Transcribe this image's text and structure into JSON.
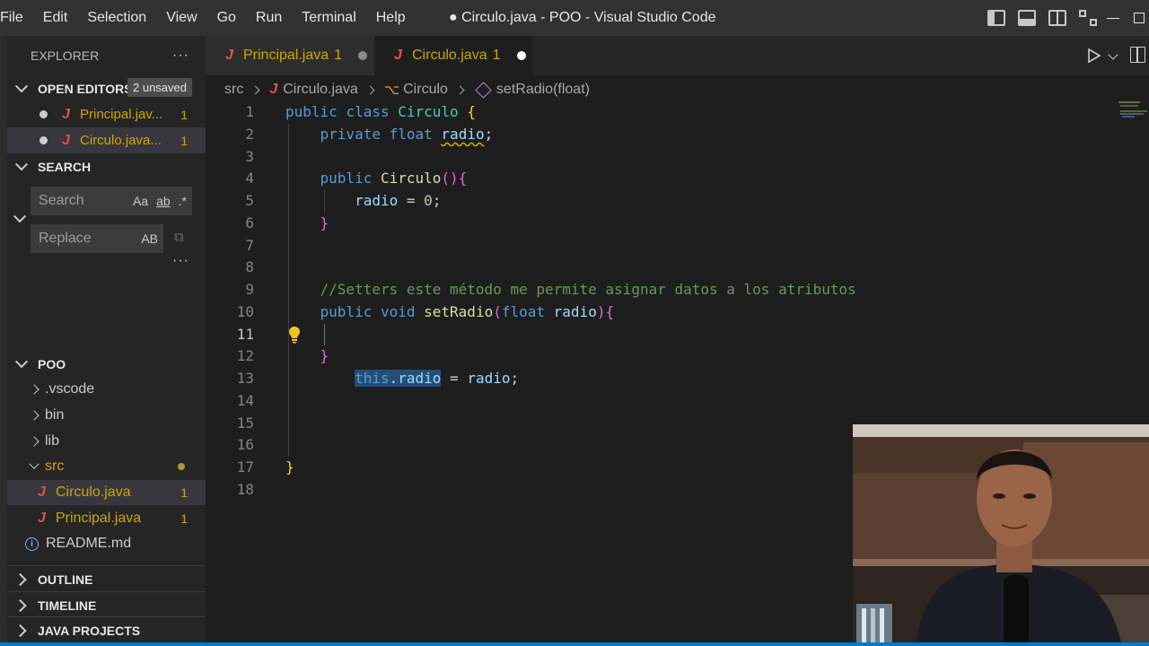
{
  "titlebar": {
    "menu": [
      "File",
      "Edit",
      "Selection",
      "View",
      "Go",
      "Run",
      "Terminal",
      "Help"
    ],
    "title": "● Circulo.java - POO - Visual Studio Code"
  },
  "sidebar": {
    "header": "EXPLORER",
    "more": "···",
    "open_editors": {
      "label": "OPEN EDITORS",
      "badge": "2 unsaved",
      "items": [
        {
          "name": "Principal.jav...",
          "count": "1"
        },
        {
          "name": "Circulo.java...",
          "count": "1"
        }
      ]
    },
    "search": {
      "label": "SEARCH",
      "search_placeholder": "Search",
      "opt_case": "Aa",
      "opt_word": "ab",
      "opt_regex": ".*",
      "replace_placeholder": "Replace",
      "opt_preserve": "AB",
      "more": "···"
    },
    "project": {
      "label": "POO",
      "items": [
        {
          "name": ".vscode"
        },
        {
          "name": "bin"
        },
        {
          "name": "lib"
        },
        {
          "name": "src"
        },
        {
          "name": "Circulo.java",
          "count": "1"
        },
        {
          "name": "Principal.java",
          "count": "1"
        },
        {
          "name": "README.md"
        }
      ]
    },
    "outline": "OUTLINE",
    "timeline": "TIMELINE",
    "java_projects": "JAVA PROJECTS"
  },
  "tabs": [
    {
      "label": "Principal.java",
      "count": "1"
    },
    {
      "label": "Circulo.java",
      "count": "1"
    }
  ],
  "breadcrumb": {
    "folder": "src",
    "file": "Circulo.java",
    "class": "Circulo",
    "method": "setRadio(float)"
  },
  "editor": {
    "line_numbers": [
      "1",
      "2",
      "3",
      "4",
      "5",
      "6",
      "7",
      "8",
      "9",
      "10",
      "11",
      "12",
      "13",
      "14",
      "15",
      "16",
      "17",
      "18"
    ],
    "current_line": 11
  },
  "colors": {
    "accent": "#007acc",
    "warning": "#cca700",
    "java": "#e8504a",
    "selection": "#264f78"
  }
}
